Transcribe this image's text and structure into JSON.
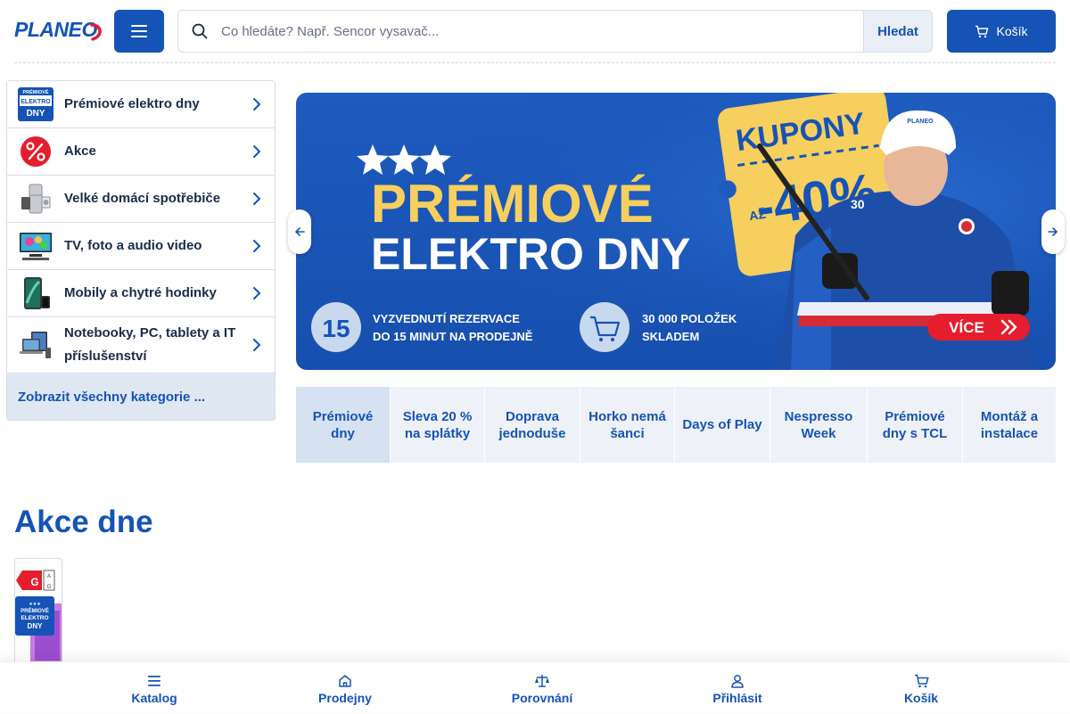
{
  "header": {
    "logo": "PLANEO",
    "search_placeholder": "Co hledáte? Např. Sencor vysavač...",
    "search_button": "Hledat",
    "cart_label": "Košík"
  },
  "sidebar": {
    "items": [
      {
        "label": "Prémiové elektro dny",
        "icon": "premium-days-icon"
      },
      {
        "label": "Akce",
        "icon": "percent-icon"
      },
      {
        "label": "Velké domácí spotřebiče",
        "icon": "fridge-icon"
      },
      {
        "label": "TV, foto a audio video",
        "icon": "tv-icon"
      },
      {
        "label": "Mobily a chytré hodinky",
        "icon": "phone-icon"
      },
      {
        "label": "Notebooky, PC, tablety a IT příslušenství",
        "icon": "laptop-icon"
      }
    ],
    "all_categories": "Zobrazit všechny kategorie ..."
  },
  "banner": {
    "headline_1": "PRÉMIOVÉ",
    "headline_2": "ELEKTRO DNY",
    "coupon_top": "KUPONY",
    "coupon_prefix": "AŽ",
    "coupon_value": "-40%",
    "badge_number": "15",
    "feature_1_line1": "VYZVEDNUTÍ REZERVACE",
    "feature_1_line2": "DO 15 MINUT NA PRODEJNĚ",
    "feature_2_line1": "30 000 POLOŽEK",
    "feature_2_line2": "SKLADEM",
    "cta": "VÍCE",
    "shirt_logo": "PLANEO",
    "shirt_number": "30",
    "colors": {
      "background": "#1d5bbf",
      "coupon": "#f6cf5e",
      "cta": "#e51d2c"
    }
  },
  "tabs": [
    {
      "label": "Prémiové dny",
      "active": true
    },
    {
      "label": "Sleva 20 % na splátky",
      "active": false
    },
    {
      "label": "Doprava jednoduše",
      "active": false
    },
    {
      "label": "Horko nemá šanci",
      "active": false
    },
    {
      "label": "Days of Play",
      "active": false
    },
    {
      "label": "Nespresso Week",
      "active": false
    },
    {
      "label": "Prémiové dny s TCL",
      "active": false
    },
    {
      "label": "Montáž a instalace",
      "active": false
    }
  ],
  "deals": {
    "title": "Akce dne",
    "energy_class": "G",
    "energy_scale_top": "A",
    "energy_scale_bottom": "G",
    "badge_line1": "PRÉMIOVÉ",
    "badge_line2": "ELEKTRO",
    "badge_line3": "DNY"
  },
  "bottom_nav": [
    {
      "label": "Katalog",
      "icon": "menu-icon"
    },
    {
      "label": "Prodejny",
      "icon": "home-icon"
    },
    {
      "label": "Porovnání",
      "icon": "scales-icon"
    },
    {
      "label": "Přihlásit",
      "icon": "user-icon"
    },
    {
      "label": "Košík",
      "icon": "cart-icon"
    }
  ],
  "colors": {
    "brand": "#1553b6",
    "tab_bg": "#eef2f8",
    "tab_active": "#d6e1f1"
  }
}
